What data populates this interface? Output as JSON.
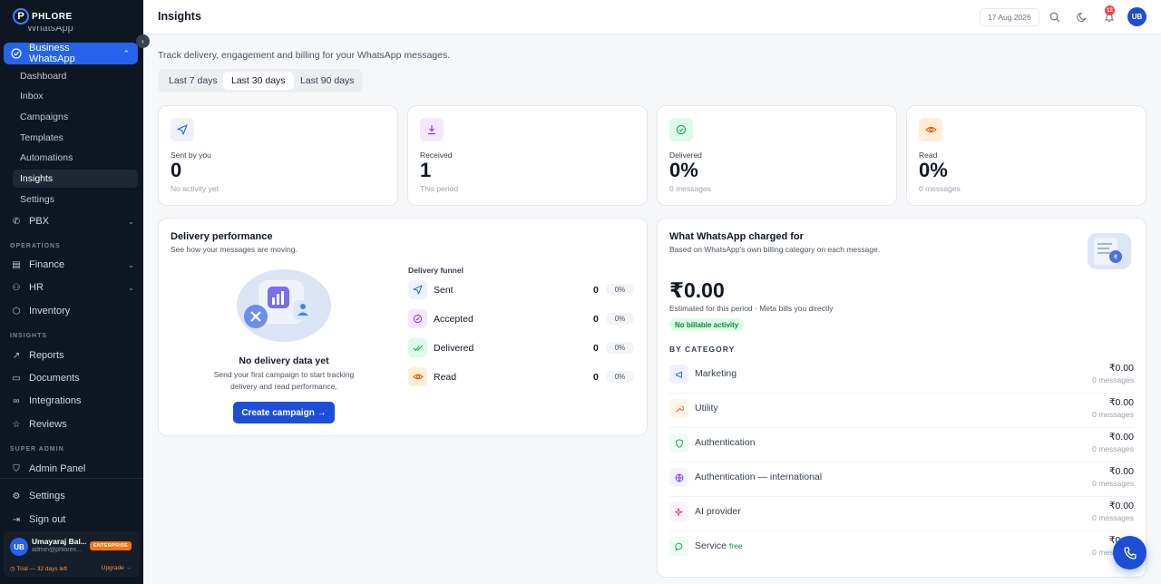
{
  "brand": {
    "name": "PHLORE",
    "mark": "P"
  },
  "sidebar": {
    "cut_item": "WhatsApp",
    "active_parent": "Business WhatsApp",
    "sub_items": [
      {
        "label": "Dashboard"
      },
      {
        "label": "Inbox"
      },
      {
        "label": "Campaigns"
      },
      {
        "label": "Templates"
      },
      {
        "label": "Automations"
      },
      {
        "label": "Insights"
      },
      {
        "label": "Settings"
      }
    ],
    "pbx": "PBX",
    "section_operations": "OPERATIONS",
    "finance": "Finance",
    "hr": "HR",
    "inventory": "Inventory",
    "section_insights": "INSIGHTS",
    "reports": "Reports",
    "documents": "Documents",
    "integrations": "Integrations",
    "reviews": "Reviews",
    "section_super_admin": "SUPER ADMIN",
    "admin_panel": "Admin Panel",
    "settings": "Settings",
    "sign_out": "Sign out"
  },
  "user": {
    "initials": "UB",
    "name": "Umayaraj Bal...",
    "email": "admin@phlorex...",
    "plan": "ENTERPRISE",
    "trial": "◷ Trial — 32 days left",
    "upgrade": "Upgrade →"
  },
  "topbar": {
    "title": "Insights",
    "date": "17 Aug 2026",
    "notifications": "12",
    "avatar": "UB"
  },
  "page": {
    "subtitle": "Track delivery, engagement and billing for your WhatsApp messages.",
    "ranges": [
      "Last 7 days",
      "Last 30 days",
      "Last 90 days"
    ],
    "active_range": "Last 30 days"
  },
  "stats": [
    {
      "label": "Sent by you",
      "value": "0",
      "sub": "No activity yet",
      "icon": "send-icon"
    },
    {
      "label": "Received",
      "value": "1",
      "sub": "This period",
      "icon": "download-icon"
    },
    {
      "label": "Delivered",
      "value": "0%",
      "sub": "0 messages",
      "icon": "check-circle-icon"
    },
    {
      "label": "Read",
      "value": "0%",
      "sub": "0 messages",
      "icon": "eye-icon"
    }
  ],
  "delivery": {
    "title": "Delivery performance",
    "desc": "See how your messages are moving.",
    "empty_title": "No delivery data yet",
    "empty_desc": "Send your first campaign to start tracking delivery and read performance.",
    "cta": "Create campaign →",
    "funnel_label": "Delivery funnel",
    "funnel": [
      {
        "name": "Sent",
        "count": "0",
        "pct": "0%"
      },
      {
        "name": "Accepted",
        "count": "0",
        "pct": "0%"
      },
      {
        "name": "Delivered",
        "count": "0",
        "pct": "0%"
      },
      {
        "name": "Read",
        "count": "0",
        "pct": "0%"
      }
    ]
  },
  "billing": {
    "title": "What WhatsApp charged for",
    "desc": "Based on WhatsApp's own billing category on each message.",
    "amount": "₹0.00",
    "note": "Estimated for this period · Meta bills you directly",
    "badge": "No billable activity",
    "by_category": "BY CATEGORY",
    "categories": [
      {
        "name": "Marketing",
        "amount": "₹0.00",
        "msgs": "0 messages",
        "free": ""
      },
      {
        "name": "Utility",
        "amount": "₹0.00",
        "msgs": "0 messages",
        "free": ""
      },
      {
        "name": "Authentication",
        "amount": "₹0.00",
        "msgs": "0 messages",
        "free": ""
      },
      {
        "name": "Authentication — international",
        "amount": "₹0.00",
        "msgs": "0 messages",
        "free": ""
      },
      {
        "name": "AI provider",
        "amount": "₹0.00",
        "msgs": "0 messages",
        "free": ""
      },
      {
        "name": "Service",
        "amount": "₹0.00",
        "msgs": "0 messages",
        "free": "free"
      }
    ]
  },
  "colors": {
    "accent": "#2563eb",
    "sidebar_bg": "#0f1623",
    "success": "#15803d",
    "warning": "#f97316"
  }
}
